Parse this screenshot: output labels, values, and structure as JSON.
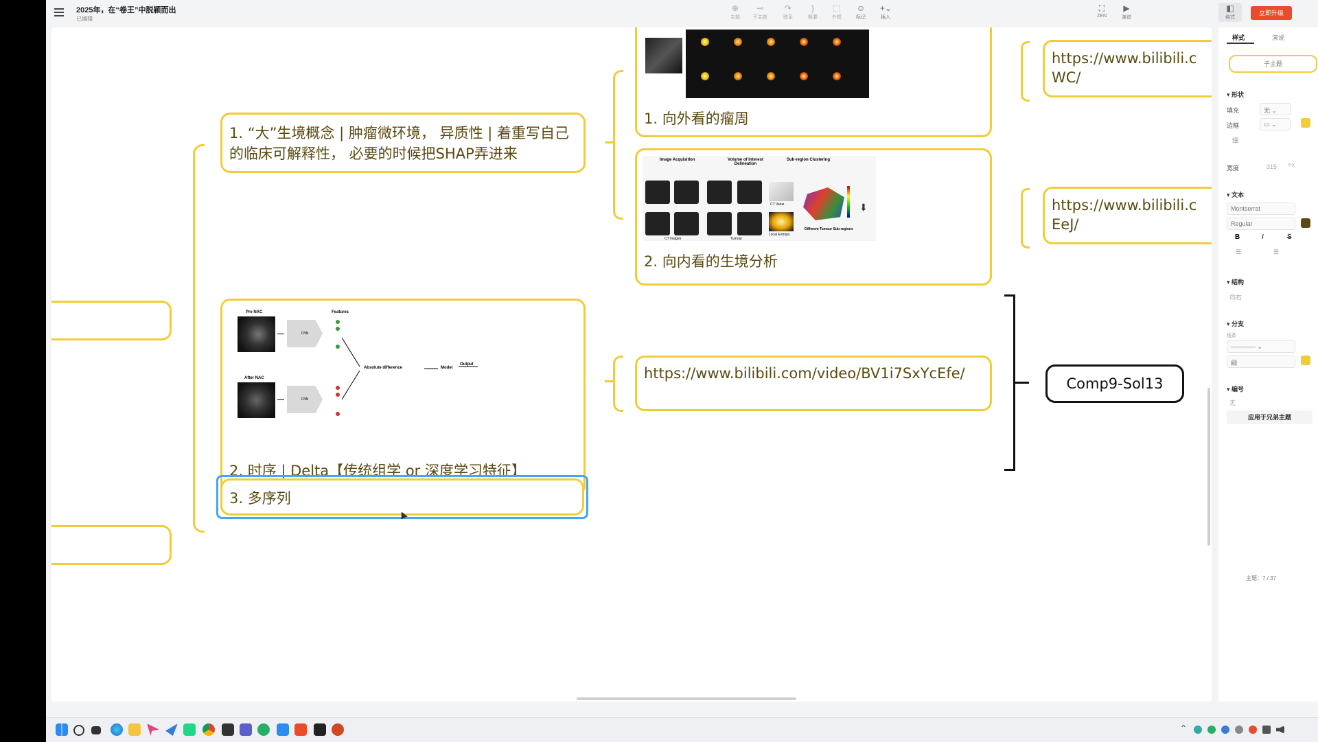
{
  "app": {
    "doc_title": "2025年，在“卷王”中脱颖而出",
    "save_status": "已编辑",
    "upgrade_label": "立即升级"
  },
  "toolbar": {
    "tools": [
      "主题",
      "子主题",
      "联系",
      "概要",
      "外框",
      "标记",
      "插入"
    ],
    "view_tools": [
      "ZEN",
      "演说"
    ],
    "format_label": "格式"
  },
  "mindmap": {
    "nodes": {
      "n1_text": "1. “大”生境概念 | 肿瘤微环境， 异质性 | 着重写自己的临床可解释性， 必要的时候把SHAP弄进来",
      "n2_text": "2. 时序 | Delta【传统组学 or 深度学习特征】",
      "n3_text": "3. 多序列",
      "child1_text": "1. 向外看的瘤周",
      "child2_text": "2. 向内看的生境分析",
      "link_main": "https://www.bilibili.com/video/BV1i7SxYcEfe/",
      "link_top_line1": "https://www.bilibili.c",
      "link_top_line2": "WC/",
      "link_mid_line1": "https://www.bilibili.c",
      "link_mid_line2": "EeJ/",
      "comp_label": "Comp9-Sol13"
    },
    "fig_delta": {
      "pre_label": "Pre NAC",
      "after_label": "After NAC",
      "features_label": "Features",
      "cnn_label": "CNN",
      "absdiff_label": "Absolute difference",
      "model_label": "Model",
      "output_label": "Output"
    },
    "fig_habitat": {
      "step1": "Image Acquisition",
      "step2": "Volume of Interest Delineation",
      "step3": "Sub-region Clustering",
      "ct_value": "CT Value",
      "local_entropy": "Local Entropy",
      "subregions": "Different Tumour Sub-regions",
      "ct_images": "CT Images",
      "tumour": "Tumour"
    }
  },
  "right_panel": {
    "tabs": [
      "样式",
      "演说"
    ],
    "subtopic_btn": "子主题",
    "shape_header": "形状",
    "fill_label": "填充",
    "fill_value": "无",
    "border_label": "边框",
    "thin_label": "细",
    "width_label": "宽度",
    "width_value": "315",
    "width_unit": "PX",
    "text_header": "文本",
    "font_value": "Montserrat",
    "weight_value": "Regular",
    "bold": "B",
    "italic": "I",
    "strike": "S",
    "structure_header": "结构",
    "structure_value": "向右",
    "branch_header": "分支",
    "line_label": "线条",
    "line_thin": "细",
    "numbering_header": "编号",
    "numbering_value": "无",
    "apply_btn": "应用于兄弟主题",
    "status": "主题：7 / 37"
  },
  "colors": {
    "node_border": "#f1cc39",
    "selected": "#42a5f5",
    "accent": "#e94b2b"
  }
}
